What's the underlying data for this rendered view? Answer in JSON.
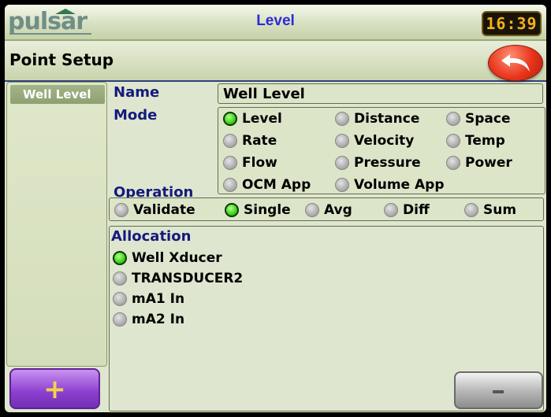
{
  "app": {
    "title": "Level",
    "clock": "16:39"
  },
  "brand": {
    "logo_text": "pulsar",
    "accent": "#2d2ad6"
  },
  "header": {
    "title": "Point Setup"
  },
  "sidebar": {
    "items": [
      {
        "label": "Well Level",
        "selected": true
      }
    ],
    "add_label": "+"
  },
  "form": {
    "name_label": "Name",
    "name_value": "Well Level",
    "mode_label": "Mode",
    "operation_label": "Operation",
    "allocation_label": "Allocation",
    "modes": [
      {
        "label": "Level",
        "selected": true
      },
      {
        "label": "Distance",
        "selected": false
      },
      {
        "label": "Space",
        "selected": false
      },
      {
        "label": "Rate",
        "selected": false
      },
      {
        "label": "Velocity",
        "selected": false
      },
      {
        "label": "Temp",
        "selected": false
      },
      {
        "label": "Flow",
        "selected": false
      },
      {
        "label": "Pressure",
        "selected": false
      },
      {
        "label": "Power",
        "selected": false
      },
      {
        "label": "OCM App",
        "selected": false
      },
      {
        "label": "Volume App",
        "selected": false
      }
    ],
    "operations": [
      {
        "label": "Validate",
        "selected": false
      },
      {
        "label": "Single",
        "selected": true
      },
      {
        "label": "Avg",
        "selected": false
      },
      {
        "label": "Diff",
        "selected": false
      },
      {
        "label": "Sum",
        "selected": false
      }
    ],
    "allocations": [
      {
        "label": "Well Xducer",
        "selected": true
      },
      {
        "label": "TRANSDUCER2",
        "selected": false
      },
      {
        "label": "mA1 In",
        "selected": false
      },
      {
        "label": "mA2 In",
        "selected": false
      }
    ],
    "remove_label": "-"
  }
}
